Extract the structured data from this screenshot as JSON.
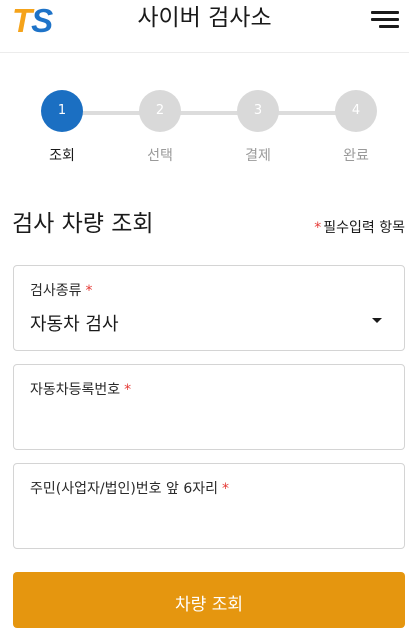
{
  "header": {
    "logo_t": "T",
    "logo_s": "S",
    "title": "사이버 검사소",
    "menu_icon": "hamburger-menu-icon"
  },
  "stepper": {
    "current_step": 1,
    "steps": [
      {
        "number": "1",
        "label": "조회"
      },
      {
        "number": "2",
        "label": "선택"
      },
      {
        "number": "3",
        "label": "결제"
      },
      {
        "number": "4",
        "label": "완료"
      }
    ]
  },
  "section": {
    "title": "검사 차량 조회",
    "required_star": "*",
    "required_note": "필수입력 항목"
  },
  "form": {
    "inspection_type": {
      "label": "검사종류",
      "required": "*",
      "value": "자동차 검사"
    },
    "registration_number": {
      "label": "자동차등록번호",
      "required": "*",
      "value": ""
    },
    "id_number": {
      "label": "주민(사업자/법인)번호 앞 6자리",
      "required": "*",
      "value": ""
    },
    "submit_label": "차량 조회"
  },
  "colors": {
    "brand_orange": "#e5960f",
    "logo_t": "#f5a31a",
    "logo_s": "#1e73c8",
    "active_step": "#1b6fc2",
    "inactive_step": "#d9d9d9",
    "required": "#e53935"
  }
}
